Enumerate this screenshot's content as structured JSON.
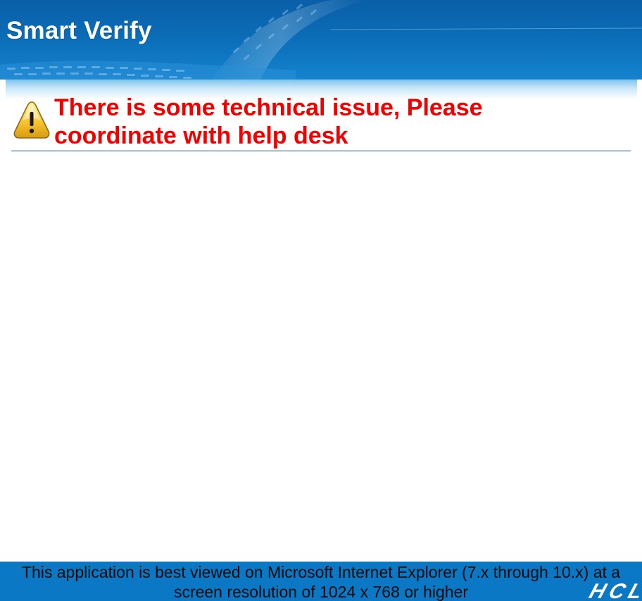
{
  "header": {
    "title": "Smart Verify"
  },
  "message": {
    "icon": "warning-icon",
    "text": "There is some technical issue, Please coordinate with help desk",
    "color": "#f20000"
  },
  "footer": {
    "text": "This application is best viewed on Microsoft Internet Explorer (7.x through 10.x) at a screen resolution of 1024 x 768 or higher",
    "logo": "HCL"
  },
  "colors": {
    "header_bg": "#0b6cb6",
    "footer_bg": "#0b78c6",
    "divider": "#1f4f93"
  }
}
